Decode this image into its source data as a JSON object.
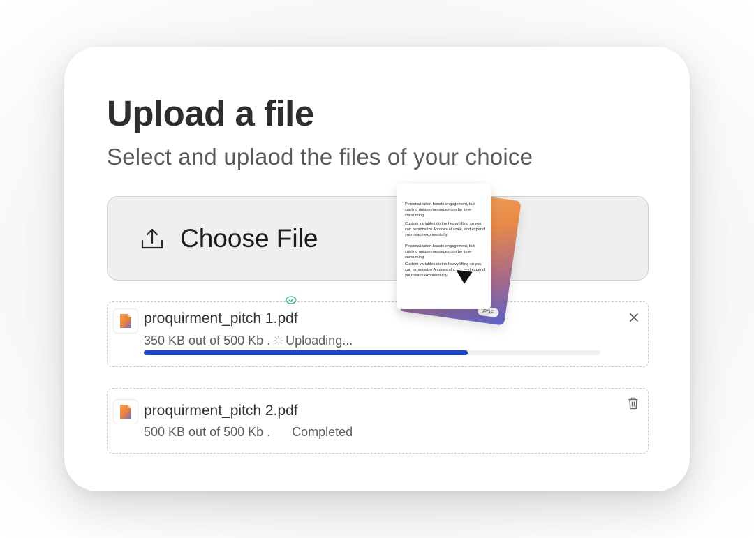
{
  "header": {
    "title": "Upload a file",
    "subtitle": "Select and uplaod the files of your choice"
  },
  "picker": {
    "icon": "upload-icon",
    "label": "Choose File"
  },
  "preview": {
    "paragraphs": [
      "Personalization boosts engagement, but crafting unique messages can be time-consuming.",
      "Custom variables do the heavy lifting so you can personalize Arcades at scale, and expand your reach exponentially.",
      "Personalization boosts engagement, but crafting unique messages can be time-consuming.",
      "Custom variables do the heavy lifting so you can personalize Arcades at scale, and expand your reach exponentially."
    ],
    "tag": "PDF"
  },
  "files": [
    {
      "name": "proquirment_pitch 1.pdf",
      "size_text": "350 KB out of 500 Kb .",
      "status": "Uploading...",
      "progress": 0.71,
      "action_icon": "close-icon"
    },
    {
      "name": "proquirment_pitch 2.pdf",
      "size_text": "500 KB out of 500 Kb .",
      "status": "Completed",
      "action_icon": "trash-icon"
    }
  ],
  "colors": {
    "progress": "#1f46c7",
    "check": "#22b36b"
  }
}
